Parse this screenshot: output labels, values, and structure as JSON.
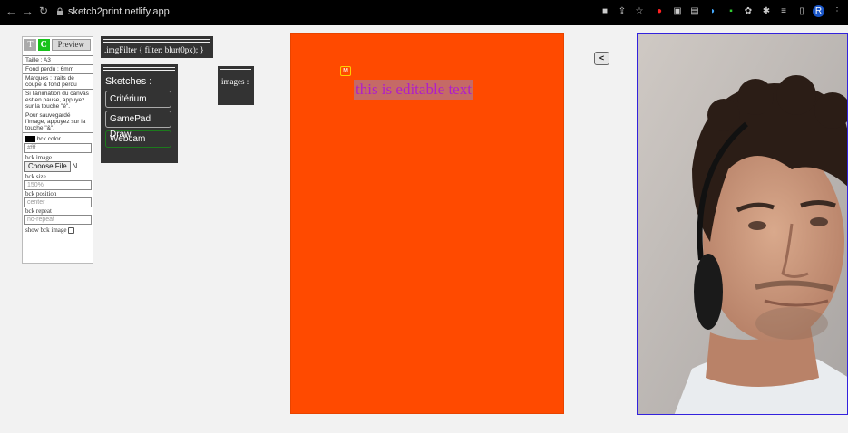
{
  "browser": {
    "url": "sketch2print.netlify.app",
    "profile_initial": "R"
  },
  "panel": {
    "t_label": "T",
    "c_label": "C",
    "preview_label": "Preview",
    "taille": "Taille : A3",
    "fond_perdu": "Fond perdu : 6mm",
    "marques": "Marques : traits de coupe & fond perdu",
    "animation_note": "Si l'animation du canvas est en pause, appuyez sur la touche \"é\".",
    "save_note": "Pour sauvegardé l'image, appuyez sur la touche \"&\".",
    "bck_color_label": "bck color",
    "bck_color_value": "#fff",
    "bck_image_label": "bck image",
    "choose_file_label": "Choose File",
    "no_file_label": "N...",
    "bck_size_label": "bck size",
    "bck_size_placeholder": "150%",
    "bck_position_label": "bck position",
    "bck_position_placeholder": "center",
    "bck_repeat_label": "bck repeat",
    "bck_repeat_placeholder": "no-repeat",
    "show_bck_image_label": "show bck image"
  },
  "imgfilter": {
    "text": ".imgFilter { filter: blur(0px); }"
  },
  "sketches": {
    "title": "Sketches :",
    "items": [
      {
        "label": "Critérium"
      },
      {
        "label": "GamePad Draw"
      },
      {
        "label": "Webcam"
      }
    ]
  },
  "images": {
    "label": "images :"
  },
  "canvas": {
    "m_badge": "M",
    "editable_text": "this is editable text",
    "color": "#ff4a00"
  },
  "collapse": {
    "label": "<"
  }
}
